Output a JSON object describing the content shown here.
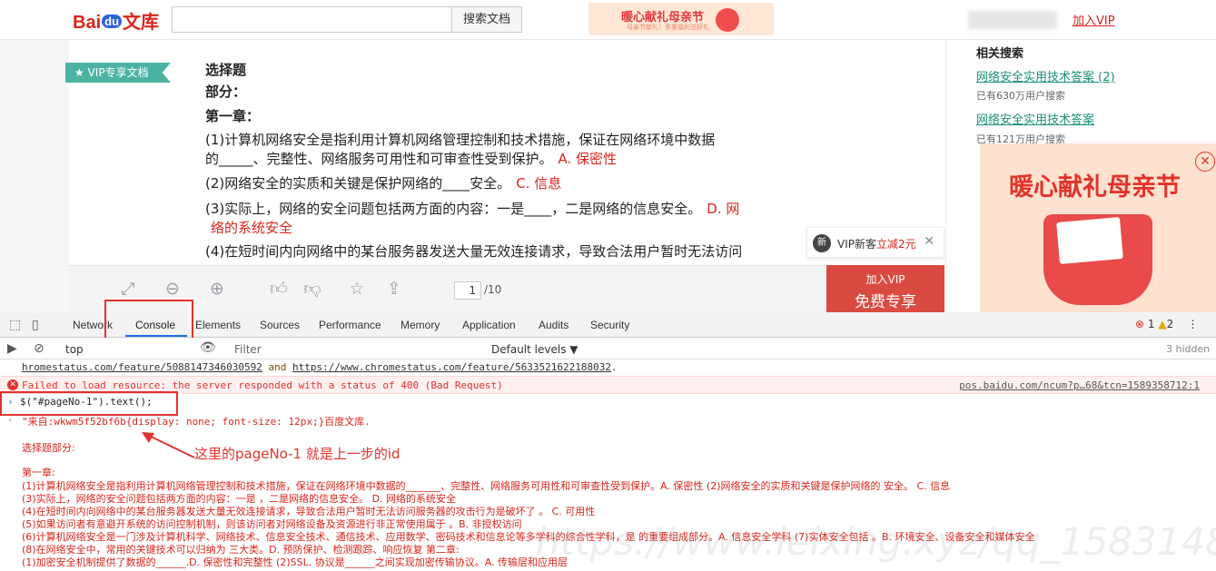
{
  "header": {
    "logo_main": "Bai",
    "logo_du": "du",
    "logo_suffix": "文库",
    "search_button": "搜索文档",
    "banner_title": "暖心献礼母亲节",
    "banner_sub": "母亲节献礼！多重福利送好礼",
    "join_vip": "加入VIP"
  },
  "doc": {
    "vip_tag": "VIP专享文档",
    "lines": [
      {
        "text": "选择题",
        "bold": true
      },
      {
        "text": "部分：",
        "bold": true
      },
      {
        "text": "第一章：",
        "bold": true
      },
      {
        "text": "(1)计算机网络安全是指利用计算机网络管理控制和技术措施，保证在网络环境中数据"
      },
      {
        "text": "的_____、完整性、网络服务可用性和可审查性受到保护。",
        "red": "A. 保密性"
      },
      {
        "text": "(2)网络安全的实质和关键是保护网络的____安全。",
        "red": "C. 信息"
      },
      {
        "text": "(3)实际上，网络的安全问题包括两方面的内容：一是____，二是网络的信息安全。",
        "red": "D. 网"
      },
      {
        "text": "",
        "red": "络的系统安全"
      },
      {
        "text": "(4)在短时间内向网络中的某台服务器发送大量无效连接请求，导致合法用户暂时无法访问"
      }
    ],
    "page_current": "1",
    "page_total": "/10",
    "vip_new_badge": "新",
    "vip_new_text": "VIP新客",
    "vip_new_link": "立减2元",
    "free_line1": "加入VIP",
    "free_line2": "免费专享"
  },
  "related": {
    "heading": "相关搜索",
    "items": [
      {
        "label": "网络安全实用技术答案 (2)",
        "count": "已有630万用户搜索"
      },
      {
        "label": "网络安全实用技术答案",
        "count": "已有121万用户搜索"
      }
    ],
    "popup_title": "暖心献礼母亲节"
  },
  "devtools": {
    "tabs": [
      "Network",
      "Console",
      "Elements",
      "Sources",
      "Performance",
      "Memory",
      "Application",
      "Audits",
      "Security"
    ],
    "active_tab": "Console",
    "error_count": "1",
    "warning_count": "2",
    "context": "top",
    "filter_placeholder": "Filter",
    "levels": "Default levels ▼",
    "hidden": "3 hidden",
    "warn_text_a": "hromestatus.com/feature/5088147346030592",
    "warn_text_and": " and ",
    "warn_text_b": "https://www.chromestatus.com/feature/5633521622188032",
    "warn_text_end": ".",
    "error_message": "Failed to load resource: the server responded with a status of 400 (Bad Request)",
    "error_source": "pos.baidu.com/ncum?p…68&tcn=1589358712:1",
    "command": "$(\"#pageNo-1\").text();",
    "output_first": "\"来自:wkwm5f52bf6b{display: none; font-size: 12px;}百度文库.",
    "output_lines": [
      "选择题部分:",
      "",
      "第一章:",
      "(1)计算机网络安全是指利用计算机网络管理控制和技术措施，保证在网络环境中数据的_______、完整性、网络服务可用性和可审查性受到保护。A. 保密性     (2)网络安全的实质和关键是保护网络的     安全。 C. 信息",
      "(3)实际上，网络的安全问题包括两方面的内容：一是      ，二是网络的信息安全。 D. 网络的系统安全",
      "(4)在短时间内向网络中的某台服务器发送大量无效连接请求，导致合法用户暂时无法访问服务器的攻击行为是破坏了     。 C. 可用性",
      "(5)如果访问者有意避开系统的访问控制机制，则该访问者对网络设备及资源进行非正常使用属于     。B. 非授权访问",
      "(6)计算机网络安全是一门涉及计算机科学、网络技术、信息安全技术、通信技术、应用数学、密码技术和信息论等多学科的综合性学科，是      的重要组成部分。A. 信息安全学科 (7)实体安全包括      。B. 环境安全、设备安全和媒体安全",
      "(8)在网络安全中，常用的关键技术可以归纳为     三大类。D. 预防保护、检测跟踪、响应恢复 第二章:",
      "(1)加密安全机制提供了数据的______.D. 保密性和完整性 (2)SSL. 协议是______之间实现加密传输协议。A. 传输层和应用层"
    ],
    "annotation": "这里的pageNo-1 就是上一步的id"
  },
  "colors": {
    "brand_red": "#d9251c",
    "link_green": "#1a8f78",
    "annotation_red": "#e3322d",
    "vip_tag_green": "#4bb3a2"
  }
}
